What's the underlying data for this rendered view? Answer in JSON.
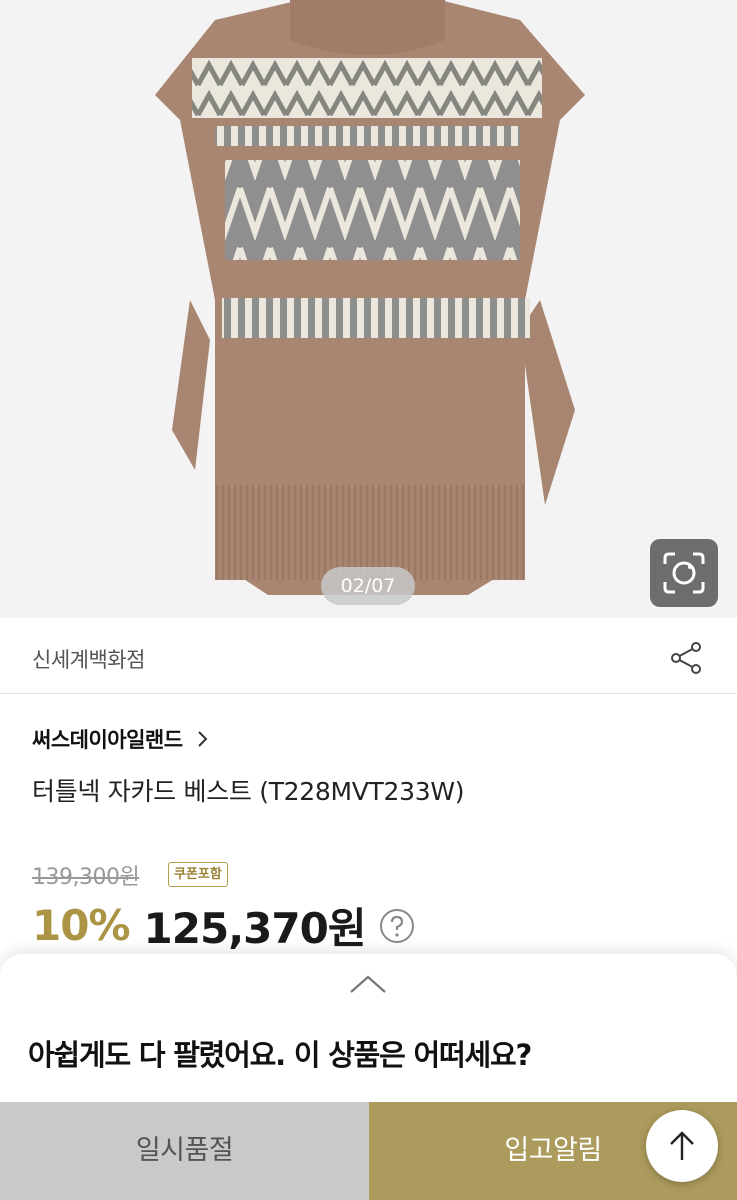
{
  "image": {
    "page_indicator": "02/07",
    "image_search_icon": "camera-lens-icon"
  },
  "seller": {
    "name": "신세계백화점",
    "share_icon": "share-icon"
  },
  "product": {
    "brand": "써스데이아일랜드",
    "name": "터틀넥 자카드 베스트 (T228MVT233W)",
    "original_price": "139,300원",
    "coupon_badge": "쿠폰포함",
    "discount": "10%",
    "sale_price": "125,370원"
  },
  "sheet": {
    "message": "아쉽게도 다 팔렸어요. 이 상품은 어떠세요?",
    "soldout_label": "일시품절",
    "notify_label": "입고알림"
  },
  "colors": {
    "accent_gold": "#ac9445",
    "notify_button": "#ac9b5c",
    "soldout_button": "#c9c9c9"
  }
}
